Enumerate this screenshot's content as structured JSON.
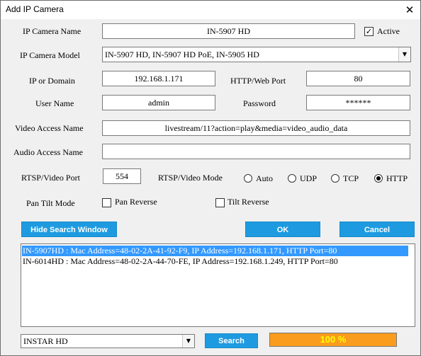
{
  "window": {
    "title": "Add IP Camera",
    "close_glyph": "✕"
  },
  "form": {
    "camera_name": {
      "label": "IP Camera Name",
      "value": "IN-5907 HD"
    },
    "active": {
      "label": "Active",
      "checked": true
    },
    "camera_model": {
      "label": "IP Camera Model",
      "value": "IN-5907 HD, IN-5907 HD PoE, IN-5905 HD"
    },
    "ip_domain": {
      "label": "IP or Domain",
      "value": "192.168.1.171"
    },
    "http_port": {
      "label": "HTTP/Web Port",
      "value": "80"
    },
    "user_name": {
      "label": "User Name",
      "value": "admin"
    },
    "password": {
      "label": "Password",
      "value": "******"
    },
    "video_access": {
      "label": "Video Access Name",
      "value": "livestream/11?action=play&media=video_audio_data"
    },
    "audio_access": {
      "label": "Audio Access Name",
      "value": ""
    },
    "rtsp_port": {
      "label": "RTSP/Video Port",
      "value": "554"
    },
    "rtsp_mode": {
      "label": "RTSP/Video Mode",
      "options": [
        "Auto",
        "UDP",
        "TCP",
        "HTTP"
      ],
      "selected": "HTTP"
    },
    "pan_tilt": {
      "label": "Pan Tilt Mode",
      "pan_reverse": {
        "label": "Pan Reverse",
        "checked": false
      },
      "tilt_reverse": {
        "label": "Tilt Reverse",
        "checked": false
      }
    }
  },
  "buttons": {
    "hide_search": "Hide Search Window",
    "ok": "OK",
    "cancel": "Cancel",
    "search": "Search"
  },
  "search_results": [
    {
      "text": "IN-5907HD : Mac Address=48-02-2A-41-92-F9,  IP Address=192.168.1.171,  HTTP Port=80",
      "selected": true
    },
    {
      "text": "IN-6014HD : Mac Address=48-02-2A-44-70-FE,  IP Address=192.168.1.249,  HTTP Port=80",
      "selected": false
    }
  ],
  "search_filter": {
    "value": "INSTAR HD"
  },
  "progress": {
    "label": "100 %",
    "percent": 100
  },
  "icons": {
    "dropdown": "▼",
    "check": "✓"
  },
  "colors": {
    "button": "#1e9be0",
    "selection": "#3399ff",
    "progress_fill": "#fa9c1e",
    "progress_text": "#ffff00"
  }
}
